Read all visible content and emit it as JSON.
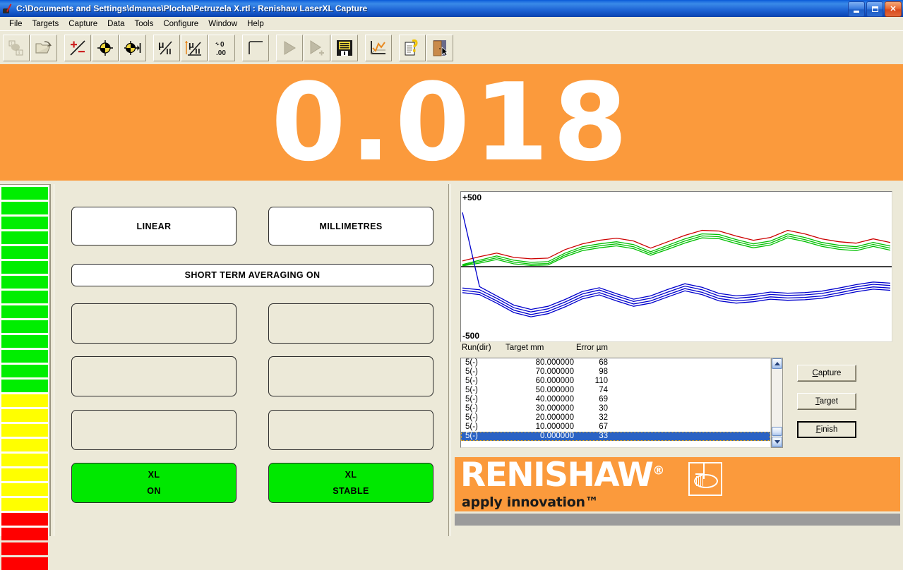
{
  "window": {
    "title": "C:\\Documents and Settings\\dmanas\\Plocha\\Petruzela X.rtl : Renishaw LaserXL Capture",
    "icon": "laser-app-icon",
    "controls": {
      "minimize": "Minimize",
      "restore": "Restore",
      "close": "Close"
    }
  },
  "menu": {
    "items": [
      {
        "label": "File"
      },
      {
        "label": "Targets"
      },
      {
        "label": "Capture"
      },
      {
        "label": "Data"
      },
      {
        "label": "Tools"
      },
      {
        "label": "Configure"
      },
      {
        "label": "Window"
      },
      {
        "label": "Help"
      }
    ]
  },
  "toolbar": {
    "buttons": [
      {
        "name": "new-file-icon",
        "tip": "New"
      },
      {
        "name": "open-folder-icon",
        "tip": "Open"
      },
      {
        "name": "plus-minus-icon",
        "tip": "Sign convention"
      },
      {
        "name": "target-icon",
        "tip": "Target"
      },
      {
        "name": "target-to-end-icon",
        "tip": "Target to end"
      },
      {
        "name": "micron-per-unit-icon",
        "tip": "Units micron"
      },
      {
        "name": "micron-slope-icon",
        "tip": "Units micron slope"
      },
      {
        "name": "decimal-places-icon",
        "tip": "Decimal places"
      },
      {
        "name": "curve-icon",
        "tip": "Compensation curve"
      },
      {
        "name": "play-icon",
        "tip": "Run"
      },
      {
        "name": "play-add-icon",
        "tip": "Run add"
      },
      {
        "name": "save-disk-icon",
        "tip": "Save"
      },
      {
        "name": "chart-icon",
        "tip": "Analyse"
      },
      {
        "name": "help-icon",
        "tip": "Help"
      },
      {
        "name": "exit-door-icon",
        "tip": "Exit"
      }
    ]
  },
  "readout": {
    "value": "0.018",
    "background": "#fb9a3c"
  },
  "signal_bar": {
    "green_count": 14,
    "yellow_count": 8,
    "red_count": 4,
    "green": "#00ee00",
    "yellow": "#ffff00",
    "red": "#ff0000"
  },
  "status_panels": [
    {
      "name": "measurement-mode-panel",
      "label": "LINEAR",
      "style": "white"
    },
    {
      "name": "units-panel",
      "label": "MILLIMETRES",
      "style": "white"
    },
    {
      "name": "averaging-panel",
      "label": "SHORT TERM AVERAGING ON",
      "style": "white"
    },
    {
      "name": "blank-panel-1",
      "label": "",
      "style": "empty"
    },
    {
      "name": "blank-panel-2",
      "label": "",
      "style": "empty"
    },
    {
      "name": "blank-panel-3",
      "label": "",
      "style": "empty"
    },
    {
      "name": "blank-panel-4",
      "label": "",
      "style": "empty"
    },
    {
      "name": "blank-panel-5",
      "label": "",
      "style": "empty"
    },
    {
      "name": "blank-panel-6",
      "label": "",
      "style": "empty"
    },
    {
      "name": "xl-power-panel",
      "line1": "XL",
      "line2": "ON",
      "style": "green"
    },
    {
      "name": "xl-stability-panel",
      "line1": "XL",
      "line2": "STABLE",
      "style": "green"
    }
  ],
  "chart_data": {
    "type": "line",
    "title": "",
    "xlabel": "",
    "ylabel": "",
    "ylim": [
      -500,
      500
    ],
    "axis_top_label": "+500",
    "axis_bottom_label": "-500",
    "grid": false,
    "zero_line": true,
    "legend_position": "none",
    "x": [
      0,
      10,
      20,
      30,
      40,
      50,
      60,
      70,
      80,
      90,
      100,
      110,
      120,
      130,
      140,
      150,
      160,
      170,
      180,
      190,
      200,
      210,
      220,
      230,
      240,
      250
    ],
    "series": [
      {
        "name": "run-1-forward",
        "color": "#cc0000",
        "values": [
          40,
          70,
          95,
          65,
          55,
          60,
          120,
          160,
          185,
          200,
          180,
          130,
          175,
          220,
          255,
          250,
          215,
          185,
          205,
          255,
          230,
          195,
          175,
          165,
          195,
          170
        ]
      },
      {
        "name": "run-2-forward",
        "color": "#00c000",
        "values": [
          15,
          45,
          75,
          45,
          30,
          35,
          95,
          140,
          160,
          175,
          155,
          105,
          150,
          195,
          230,
          225,
          190,
          160,
          180,
          230,
          205,
          170,
          150,
          140,
          170,
          145
        ]
      },
      {
        "name": "run-3-forward",
        "color": "#00c000",
        "values": [
          10,
          35,
          62,
          32,
          18,
          22,
          82,
          126,
          146,
          160,
          140,
          92,
          136,
          180,
          216,
          210,
          176,
          146,
          166,
          216,
          190,
          156,
          136,
          126,
          156,
          130
        ]
      },
      {
        "name": "run-4-forward",
        "color": "#00c000",
        "values": [
          5,
          25,
          50,
          20,
          8,
          12,
          70,
          112,
          132,
          146,
          126,
          80,
          122,
          166,
          202,
          196,
          162,
          132,
          152,
          202,
          176,
          142,
          122,
          112,
          142,
          116
        ]
      },
      {
        "name": "run-1-reverse",
        "color": "#0000cc",
        "values": [
          380,
          -140,
          -205,
          -270,
          -300,
          -278,
          -230,
          -175,
          -148,
          -190,
          -228,
          -205,
          -160,
          -120,
          -145,
          -188,
          -205,
          -196,
          -178,
          -186,
          -182,
          -172,
          -150,
          -126,
          -108,
          -116
        ]
      },
      {
        "name": "run-2-reverse",
        "color": "#0000cc",
        "values": [
          -150,
          -162,
          -222,
          -288,
          -318,
          -296,
          -248,
          -192,
          -164,
          -206,
          -244,
          -222,
          -178,
          -136,
          -162,
          -206,
          -222,
          -212,
          -195,
          -202,
          -198,
          -188,
          -166,
          -142,
          -124,
          -132
        ]
      },
      {
        "name": "run-3-reverse",
        "color": "#0000cc",
        "values": [
          -166,
          -180,
          -240,
          -305,
          -336,
          -314,
          -266,
          -210,
          -182,
          -224,
          -262,
          -240,
          -196,
          -154,
          -180,
          -224,
          -240,
          -230,
          -212,
          -220,
          -216,
          -206,
          -184,
          -160,
          -142,
          -150
        ]
      },
      {
        "name": "run-4-reverse",
        "color": "#0000cc",
        "values": [
          -182,
          -196,
          -256,
          -322,
          -352,
          -330,
          -282,
          -226,
          -198,
          -240,
          -278,
          -256,
          -212,
          -170,
          -196,
          -240,
          -256,
          -246,
          -228,
          -236,
          -232,
          -222,
          -200,
          -176,
          -158,
          -166
        ]
      }
    ]
  },
  "results_table": {
    "columns": [
      "Run(dir)",
      "Target mm",
      "Error µm"
    ],
    "rows": [
      {
        "run": "5(-)",
        "target": "80.000000",
        "error": "68",
        "selected": false
      },
      {
        "run": "5(-)",
        "target": "70.000000",
        "error": "98",
        "selected": false
      },
      {
        "run": "5(-)",
        "target": "60.000000",
        "error": "110",
        "selected": false
      },
      {
        "run": "5(-)",
        "target": "50.000000",
        "error": "74",
        "selected": false
      },
      {
        "run": "5(-)",
        "target": "40.000000",
        "error": "69",
        "selected": false
      },
      {
        "run": "5(-)",
        "target": "30.000000",
        "error": "30",
        "selected": false
      },
      {
        "run": "5(-)",
        "target": "20.000000",
        "error": "32",
        "selected": false
      },
      {
        "run": "5(-)",
        "target": "10.000000",
        "error": "67",
        "selected": false
      },
      {
        "run": "5(-)",
        "target": "0.000000",
        "error": "33",
        "selected": true
      }
    ],
    "scrollbar": {
      "up": "scroll-up",
      "down": "scroll-down"
    }
  },
  "action_buttons": [
    {
      "name": "capture-button",
      "label": "Capture",
      "accel": "C",
      "focused": false
    },
    {
      "name": "target-button",
      "label": "Target",
      "accel": "T",
      "focused": false
    },
    {
      "name": "finish-button",
      "label": "Finish",
      "accel": "F",
      "focused": true
    }
  ],
  "branding": {
    "name": "RENISHAW",
    "registered": "®",
    "tagline": "apply innovation™",
    "background": "#fb9a3c"
  }
}
